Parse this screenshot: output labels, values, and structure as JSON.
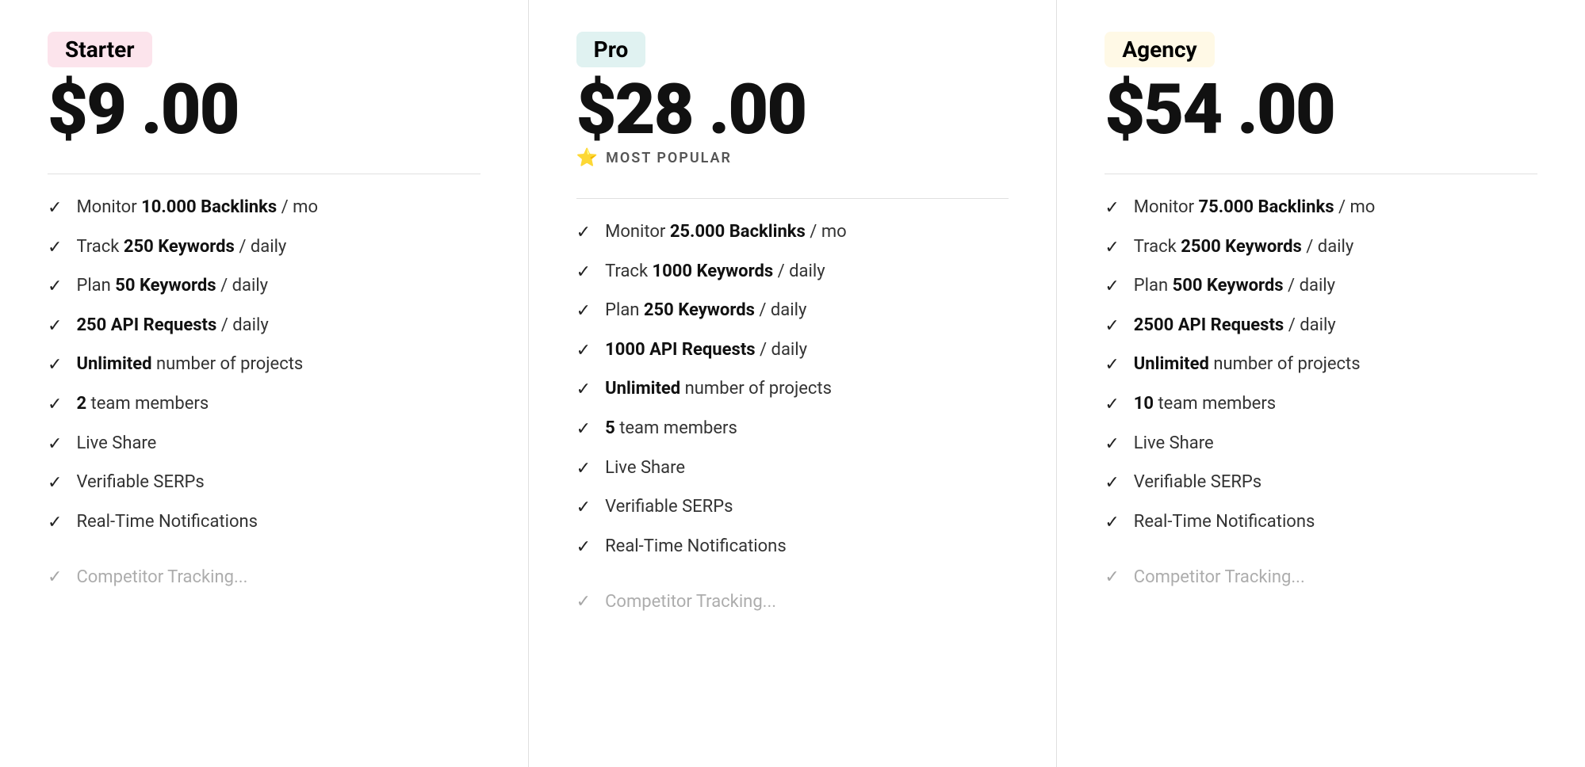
{
  "plans": [
    {
      "id": "starter",
      "badge_label": "Starter",
      "badge_class": "badge-starter",
      "price": "$9 .00",
      "most_popular": false,
      "features": [
        {
          "text_html": "Monitor <strong>10.000 Backlinks</strong> / mo"
        },
        {
          "text_html": "Track <strong>250 Keywords</strong> / daily"
        },
        {
          "text_html": "Plan <strong>50 Keywords</strong> / daily"
        },
        {
          "text_html": "<strong>250 API Requests</strong> / daily"
        },
        {
          "text_html": "<strong>Unlimited</strong> number of projects"
        },
        {
          "text_html": "<strong>2</strong> team members"
        },
        {
          "text_html": "Live Share"
        },
        {
          "text_html": "Verifiable SERPs"
        },
        {
          "text_html": "Real-Time Notifications"
        }
      ],
      "fade_label": "Competitor Tracking..."
    },
    {
      "id": "pro",
      "badge_label": "Pro",
      "badge_class": "badge-pro",
      "price": "$28 .00",
      "most_popular": true,
      "most_popular_label": "MOST POPULAR",
      "features": [
        {
          "text_html": "Monitor <strong>25.000 Backlinks</strong> / mo"
        },
        {
          "text_html": "Track <strong>1000 Keywords</strong> / daily"
        },
        {
          "text_html": "Plan <strong>250 Keywords</strong> / daily"
        },
        {
          "text_html": "<strong>1000 API Requests</strong> / daily"
        },
        {
          "text_html": "<strong>Unlimited</strong> number of projects"
        },
        {
          "text_html": "<strong>5</strong> team members"
        },
        {
          "text_html": "Live Share"
        },
        {
          "text_html": "Verifiable SERPs"
        },
        {
          "text_html": "Real-Time Notifications"
        }
      ],
      "fade_label": "Competitor Tracking..."
    },
    {
      "id": "agency",
      "badge_label": "Agency",
      "badge_class": "badge-agency",
      "price": "$54 .00",
      "most_popular": false,
      "features": [
        {
          "text_html": "Monitor <strong>75.000 Backlinks</strong> / mo"
        },
        {
          "text_html": "Track <strong>2500 Keywords</strong> / daily"
        },
        {
          "text_html": "Plan <strong>500 Keywords</strong> / daily"
        },
        {
          "text_html": "<strong>2500 API Requests</strong> / daily"
        },
        {
          "text_html": "<strong>Unlimited</strong> number of projects"
        },
        {
          "text_html": "<strong>10</strong> team members"
        },
        {
          "text_html": "Live Share"
        },
        {
          "text_html": "Verifiable SERPs"
        },
        {
          "text_html": "Real-Time Notifications"
        }
      ],
      "fade_label": "Competitor Tracking..."
    }
  ],
  "check_symbol": "✓",
  "star_symbol": "⭐"
}
